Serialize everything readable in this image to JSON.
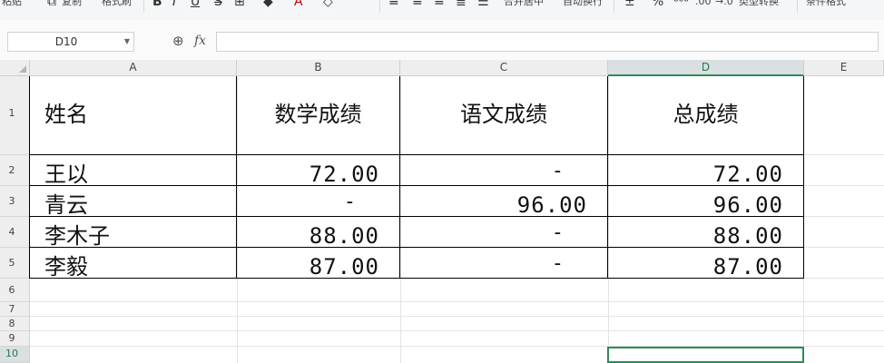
{
  "toolbar": {
    "paste": "粘贴",
    "copy": "复制",
    "format_painter": "格式刷",
    "bold": "B",
    "italic": "I",
    "underline": "U",
    "merge_center": "合并居中",
    "wrap_text": "自动换行",
    "increase_decimal": ".00",
    "decrease_decimal": "→.0",
    "type_convert": "类型转换",
    "conditional_format": "条件格式"
  },
  "formula_bar": {
    "name_box": "D10",
    "fx_label": "fx",
    "formula": ""
  },
  "columns": [
    "A",
    "B",
    "C",
    "D",
    "E"
  ],
  "selected_column": "D",
  "rows": [
    "1",
    "2",
    "3",
    "4",
    "5",
    "6",
    "7",
    "8",
    "9",
    "10"
  ],
  "selected_row": "10",
  "table": {
    "headers": [
      "姓名",
      "数学成绩",
      "语文成绩",
      "总成绩"
    ],
    "records": [
      {
        "name": "王以",
        "math": "72.00",
        "chinese": "-",
        "total": "72.00"
      },
      {
        "name": "青云",
        "math": "-",
        "chinese": "96.00",
        "total": "96.00"
      },
      {
        "name": "李木子",
        "math": "88.00",
        "chinese": "-",
        "total": "88.00"
      },
      {
        "name": "李毅",
        "math": "87.00",
        "chinese": "-",
        "total": "87.00"
      }
    ]
  },
  "colors": {
    "accent": "#2e8b57",
    "header_bg": "#eeeeee",
    "selected_header_bg": "#dadfe4"
  }
}
